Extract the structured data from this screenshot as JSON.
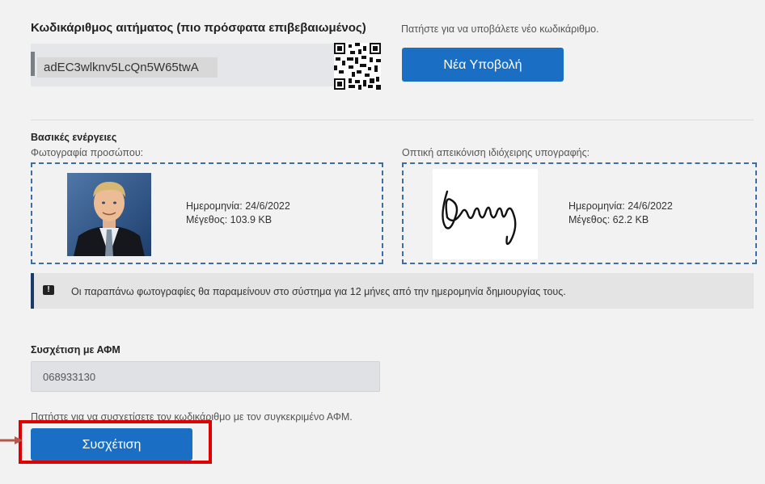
{
  "request": {
    "title": "Κωδικάριθμος αιτήματος (πιο πρόσφατα επιβεβαιωμένος)",
    "code": "adEC3wlknv5LcQn5W65twA",
    "new_hint": "Πατήστε για να υποβάλετε νέο κωδικάριθμο.",
    "new_button": "Νέα Υποβολή"
  },
  "actions": {
    "title": "Βασικές ενέργειες",
    "photo_label": "Φωτογραφία προσώπου:",
    "photo_date": "Ημερομηνία: 24/6/2022",
    "photo_size": "Μέγεθος: 103.9 KB",
    "sig_label": "Οπτική απεικόνιση ιδιόχειρης υπογραφής:",
    "sig_date": "Ημερομηνία: 24/6/2022",
    "sig_size": "Μέγεθος: 62.2 KB"
  },
  "notice": {
    "icon": "exclamation-icon",
    "text": "Οι παραπάνω φωτογραφίες θα παραμείνουν στο σύστημα για 12 μήνες από την ημερομηνία δημιουργίας τους."
  },
  "afm": {
    "title": "Συσχέτιση με ΑΦΜ",
    "value": "068933130",
    "hint": "Πατήστε για να συσχετίσετε τον κωδικάριθμο με τον συγκεκριμένο ΑΦΜ.",
    "button": "Συσχέτιση"
  },
  "colors": {
    "primary": "#1a6fc4",
    "highlight": "#e10000",
    "dashed_border": "#3b6fa5"
  }
}
